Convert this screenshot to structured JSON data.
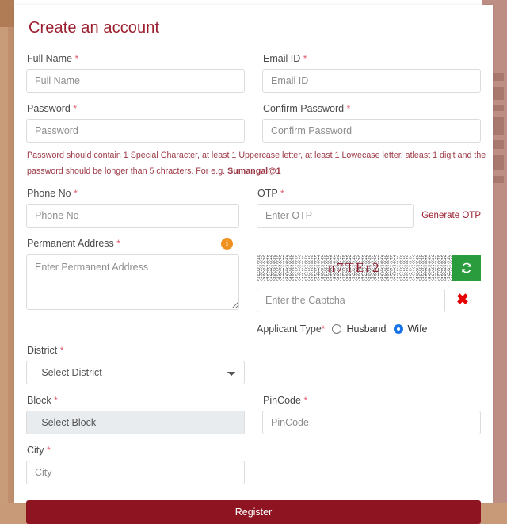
{
  "card": {
    "title": "Create an account"
  },
  "fields": {
    "full_name": {
      "label": "Full Name",
      "placeholder": "Full Name",
      "value": "",
      "required": true
    },
    "email": {
      "label": "Email ID",
      "placeholder": "Email ID",
      "value": "",
      "required": true
    },
    "password": {
      "label": "Password",
      "placeholder": "Password",
      "value": "",
      "required": true
    },
    "confirm_password": {
      "label": "Confirm Password",
      "placeholder": "Confirm Password",
      "value": "",
      "required": true
    },
    "phone": {
      "label": "Phone No",
      "placeholder": "Phone No",
      "value": "",
      "required": true
    },
    "otp": {
      "label": "OTP",
      "placeholder": "Enter OTP",
      "value": "",
      "required": true
    },
    "permanent_address": {
      "label": "Permanent Address",
      "placeholder": "Enter Permanent Address",
      "value": "",
      "required": true
    },
    "district": {
      "label": "District",
      "selected": "--Select District--",
      "required": true,
      "disabled": false
    },
    "block": {
      "label": "Block",
      "selected": "--Select Block--",
      "required": true,
      "disabled": true
    },
    "city": {
      "label": "City",
      "placeholder": "City",
      "value": "",
      "required": true
    },
    "pincode": {
      "label": "PinCode",
      "placeholder": "PinCode",
      "value": "",
      "required": true
    },
    "captcha_input": {
      "placeholder": "Enter the Captcha",
      "value": ""
    }
  },
  "password_hint": {
    "text": "Password should contain 1 Special Character, at least 1 Uppercase letter, at least 1 Lowecase letter, atleast 1 digit and the password should be longer than 5 chracters. For e.g. ",
    "example": "Sumangal@1"
  },
  "otp_action": {
    "label": "Generate OTP"
  },
  "captcha": {
    "text": "n7TEr2",
    "refresh_icon": "refresh-icon",
    "status_icon": "cross-mark-icon",
    "refresh_button_color": "#2a9c3d",
    "text_color": "#8e1f2f",
    "status_color": "#e60000"
  },
  "applicant_type": {
    "label": "Applicant Type",
    "required": true,
    "options": [
      {
        "label": "Husband",
        "selected": false
      },
      {
        "label": "Wife",
        "selected": true
      }
    ],
    "accent_color": "#1673e6"
  },
  "submit": {
    "label": "Register",
    "color": "#8d1420"
  },
  "icons": {
    "info": "info-icon"
  },
  "theme": {
    "title_color": "#9c2030",
    "required_color": "#e06070",
    "hint_color": "#9c3a47",
    "info_icon_color": "#ef9120"
  }
}
